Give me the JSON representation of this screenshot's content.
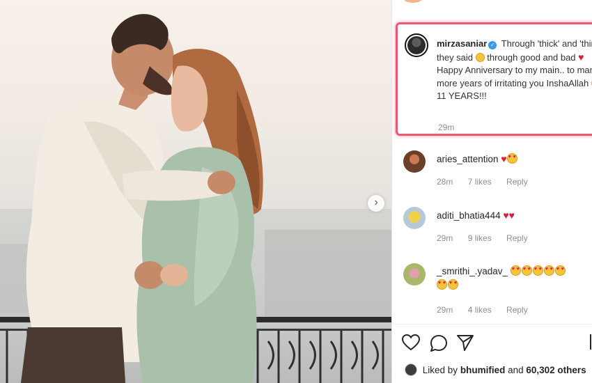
{
  "post": {
    "author": "mirzasaniar",
    "caption_parts": [
      "Through 'thick' and 'thin' they said",
      "through good and bad",
      "Happy Anniversary to my main.. to many more years of irritating you InshaAllah",
      "11 YEARS!!!"
    ],
    "time": "29m"
  },
  "comments": [
    {
      "user": "aries_attention",
      "emoji": "❤️😍",
      "time": "28m",
      "likes": "7 likes",
      "reply": "Reply"
    },
    {
      "user": "aditi_bhatia444",
      "emoji": "❤️❤️",
      "time": "29m",
      "likes": "9 likes",
      "reply": "Reply"
    },
    {
      "user": "_smrithi_.yadav_",
      "emoji": "😍😍😍😍😍😍😍",
      "time": "29m",
      "likes": "4 likes",
      "reply": "Reply"
    }
  ],
  "footer": {
    "liked_by_prefix": "Liked by",
    "liked_by_user": "bhumified",
    "liked_by_joiner": "and",
    "liked_by_count": "60,302 others"
  },
  "colors": {
    "highlight": "#e85b73",
    "verified": "#3897f0",
    "heart": "#e0183b"
  },
  "icons": {
    "like": "heart-outline-icon",
    "comment": "speech-bubble-icon",
    "share": "paper-plane-icon",
    "next": "chevron-right-icon"
  }
}
